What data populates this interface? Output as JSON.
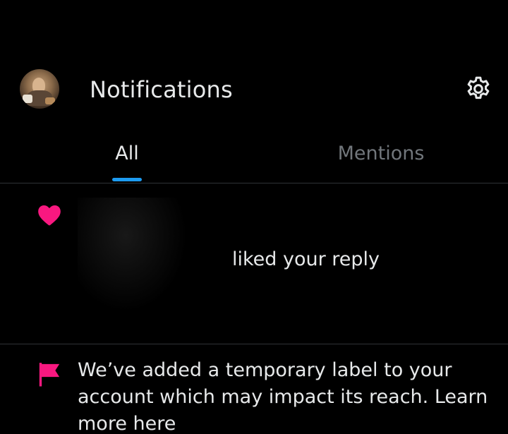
{
  "header": {
    "title": "Notifications",
    "avatar_icon": "profile-avatar",
    "settings_icon": "gear-icon"
  },
  "tabs": [
    {
      "label": "All",
      "active": true
    },
    {
      "label": "Mentions",
      "active": false
    }
  ],
  "notifications": [
    {
      "type": "like",
      "icon": "heart-icon",
      "icon_color": "#f91880",
      "text": "liked your reply"
    },
    {
      "type": "account-label",
      "icon": "flag-icon",
      "icon_color": "#f91880",
      "text": "We’ve added a temporary label to your account which may impact its reach. Learn more here"
    }
  ],
  "colors": {
    "background": "#000000",
    "text_primary": "#e7e9ea",
    "text_secondary": "#71767b",
    "accent": "#1d9bf0",
    "divider": "#2f3336",
    "pink": "#f91880"
  }
}
